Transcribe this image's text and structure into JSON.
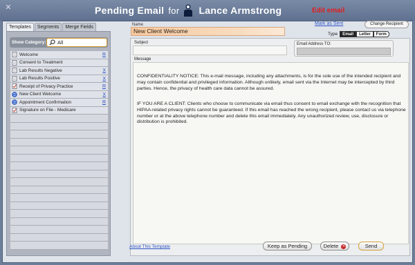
{
  "window": {
    "title_prefix": "Pending Email",
    "title_for": "for",
    "patient_name": "Lance Armstrong",
    "edit_link": "Edit email"
  },
  "left_panel": {
    "tabs": [
      {
        "label": "Templates",
        "active": true
      },
      {
        "label": "Segments",
        "active": false
      },
      {
        "label": "Merge Fields",
        "active": false
      }
    ],
    "show_category_label": "Show Category:",
    "category_value": "All",
    "templates": [
      {
        "label": "Welcome",
        "tag": "R",
        "icon": "document-icon"
      },
      {
        "label": "Consent to Treatment",
        "tag": "",
        "icon": "document-icon"
      },
      {
        "label": "Lab Results Negative",
        "tag": "X",
        "icon": "document-icon"
      },
      {
        "label": "Lab Results Positive",
        "tag": "X",
        "icon": "document-icon"
      },
      {
        "label": "Receipt of Privacy Practice",
        "tag": "R",
        "icon": "checked-document-icon"
      },
      {
        "label": "New Client Welcome",
        "tag": "X",
        "icon": "globe-icon"
      },
      {
        "label": "Appointment Confirmation",
        "tag": "R",
        "icon": "globe-icon"
      },
      {
        "label": "Signature on File - Medicare",
        "tag": "",
        "icon": "checked-document-icon"
      }
    ]
  },
  "form": {
    "name_label": "Name",
    "name_value": "New Client Welcome",
    "mark_as_sent": "Mark as Sent",
    "change_recipient": "Change Recipient",
    "type_label": "Type",
    "type_options": [
      "Email",
      "Letter",
      "Form"
    ],
    "type_selected": "Email",
    "subject_label": "Subject",
    "subject_value": "",
    "email_label": "Email Address TO:",
    "message_label": "Message",
    "message_p1": "CONFIDENTIALITY NOTICE: This e-mail message, including any attachments, is for the sole use of the intended recipient and may contain confidential and privileged information. Although unlikely, email sent via the Internet may be intercepted by third parties. Hence, the privacy of health care data cannot be assured.",
    "message_p2": "IF YOU ARE A CLIENT: Clients who choose to communicate via email thus consent to email exchange with the recognition that HIPAA-related privacy rights cannot be guaranteed. If this email has reached the wrong recipient, please contact us via telephone number or at the above telephone number and delete this email immediately. Any unauthorized review, use, disclosure or distribution is prohibited.",
    "about_template": "About This Template",
    "keep_pending": "Keep as Pending",
    "delete": "Delete",
    "send": "Send"
  },
  "colors": {
    "accent_link": "#2a52c8",
    "edit_link": "#e02020",
    "name_field": "#f6c9a0"
  }
}
